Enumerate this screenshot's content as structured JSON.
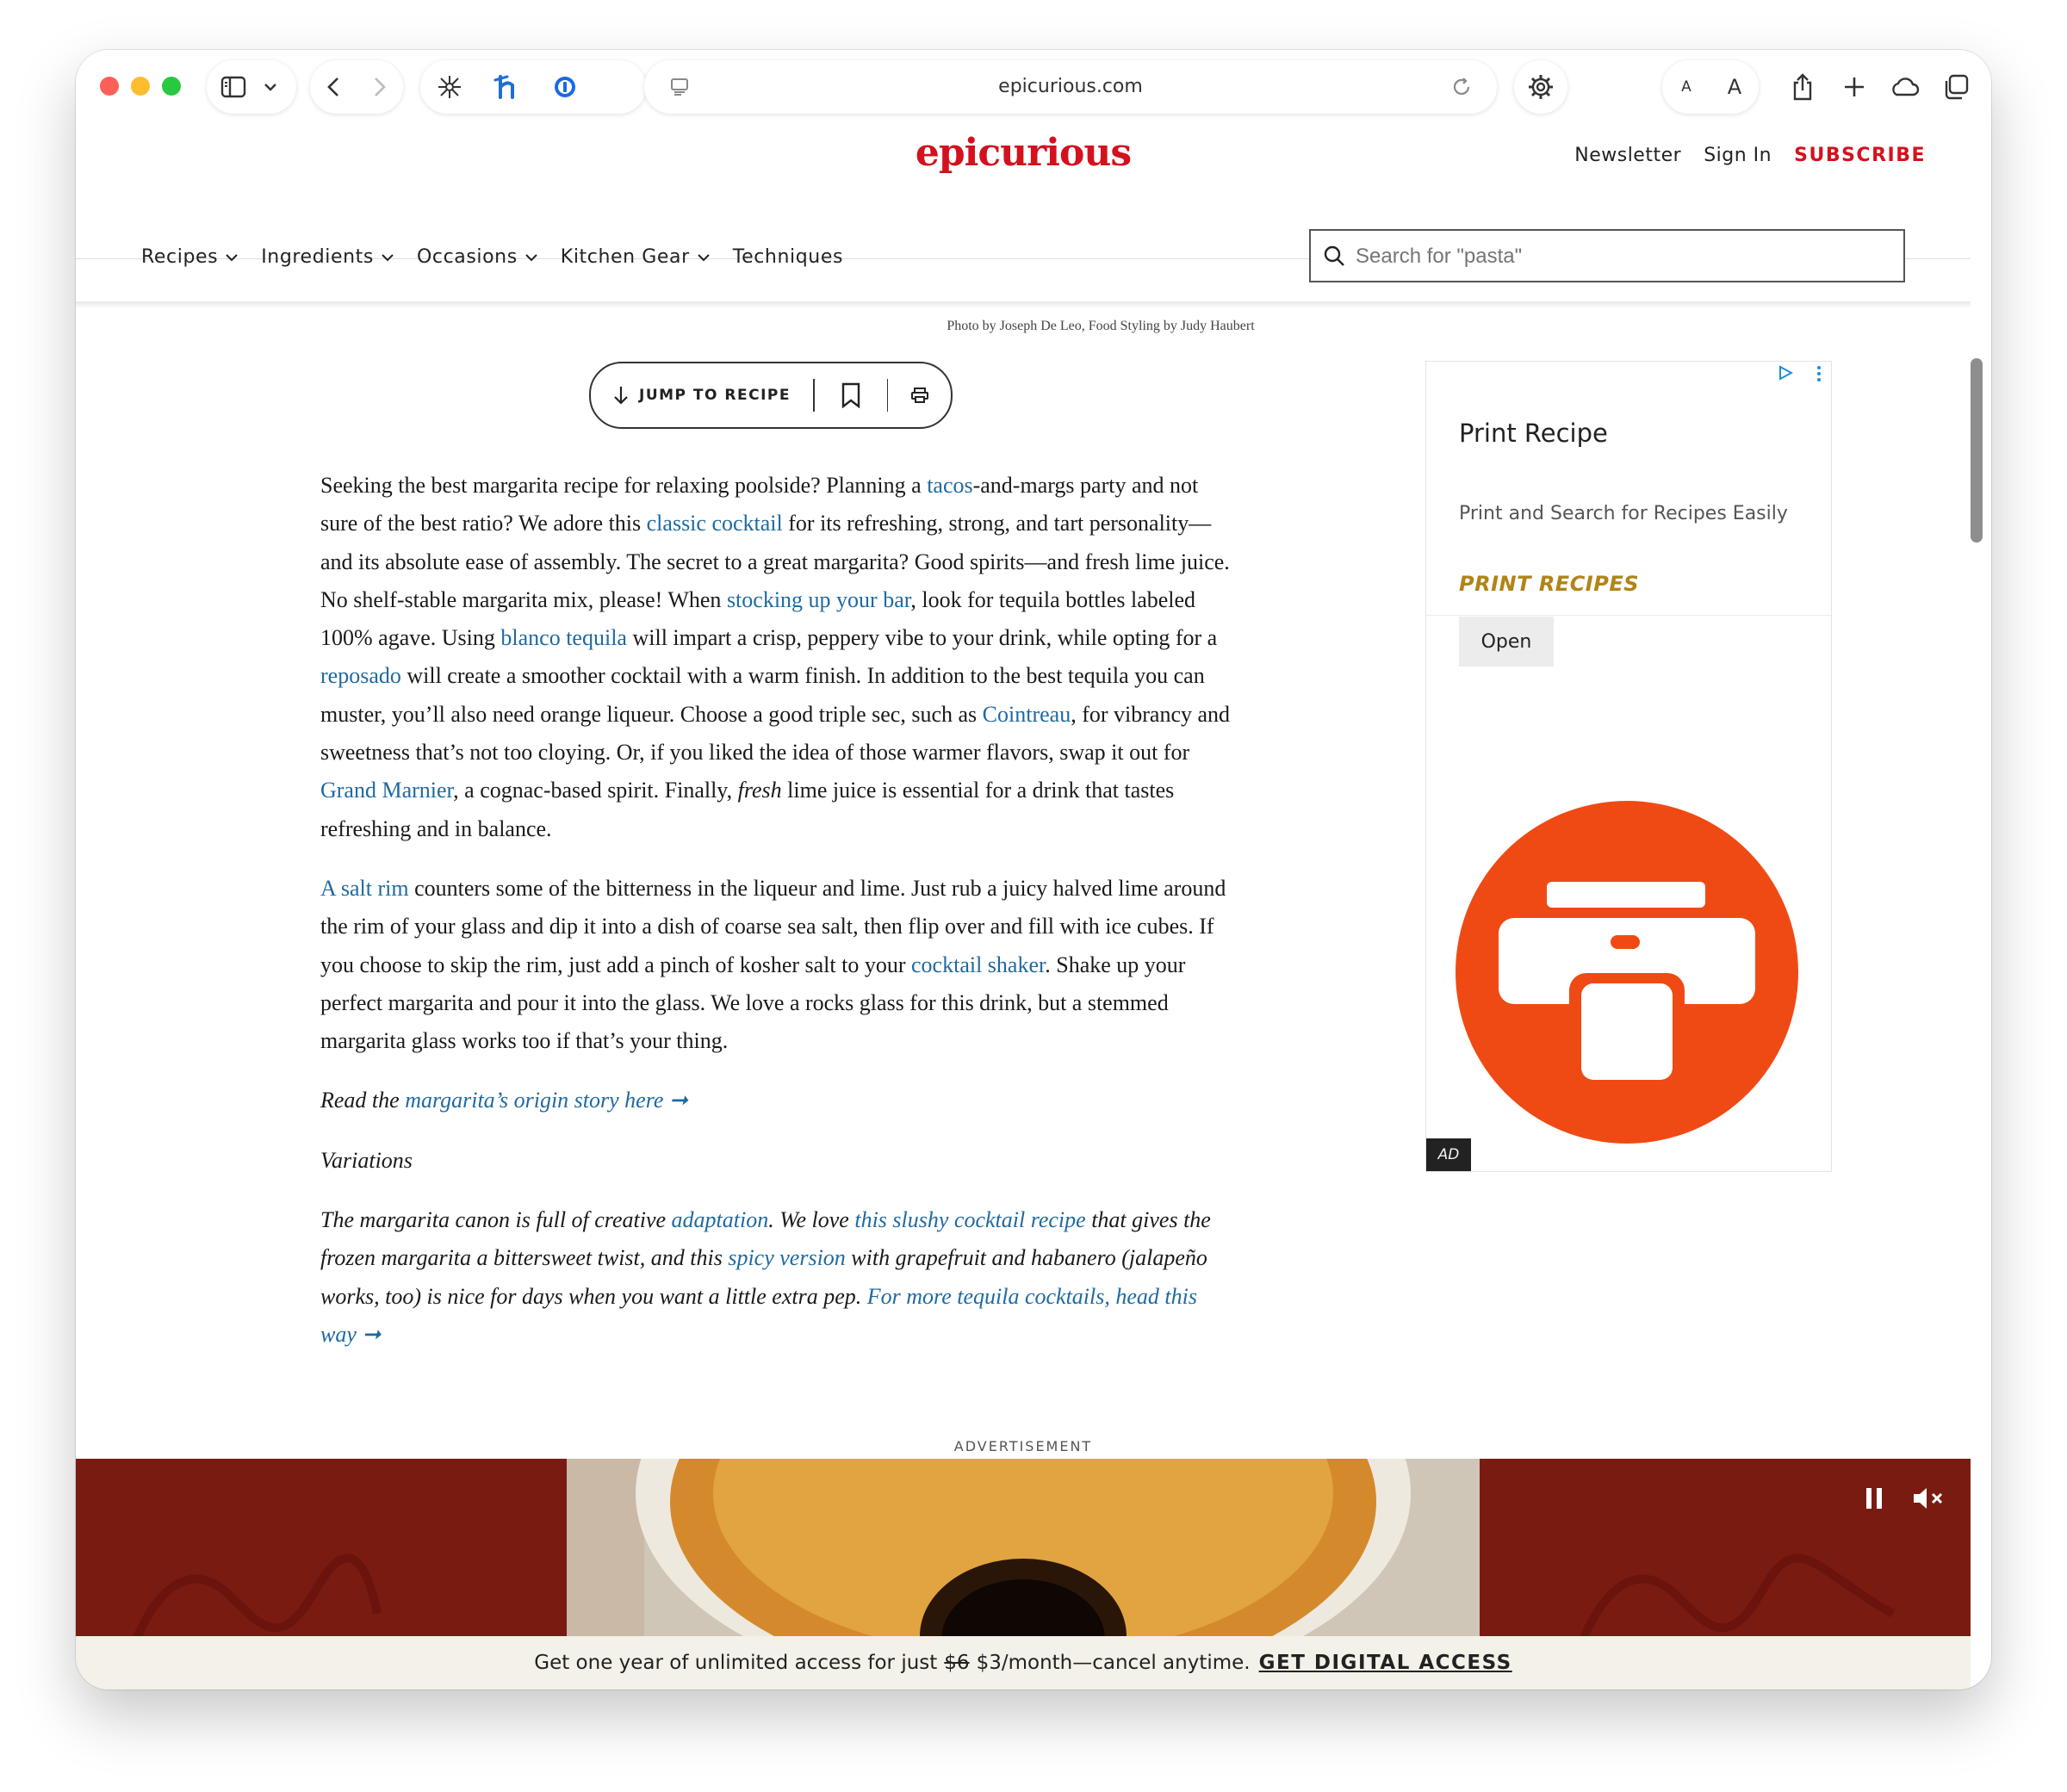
{
  "browser": {
    "url": "epicurious.com",
    "reader_small_a": "A",
    "reader_large_a": "A"
  },
  "site": {
    "logo": "epicurious",
    "header_links": {
      "newsletter": "Newsletter",
      "sign_in": "Sign In",
      "subscribe": "SUBSCRIBE"
    },
    "nav": [
      {
        "label": "Recipes",
        "has_dropdown": true
      },
      {
        "label": "Ingredients",
        "has_dropdown": true
      },
      {
        "label": "Occasions",
        "has_dropdown": true
      },
      {
        "label": "Kitchen Gear",
        "has_dropdown": true
      },
      {
        "label": "Techniques",
        "has_dropdown": false
      }
    ],
    "search_placeholder": "Search for \"pasta\""
  },
  "article": {
    "photo_credit": "Photo by Joseph De Leo, Food Styling by Judy Haubert",
    "jump_to_recipe": "JUMP TO RECIPE",
    "p1": {
      "t1": "Seeking the best margarita recipe for relaxing poolside? Planning a ",
      "l1": "tacos",
      "t2": "-and-margs party and not sure of the best ratio? We adore this ",
      "l2": "classic cocktail",
      "t3": " for its refreshing, strong, and tart personality—and its absolute ease of assembly. The secret to a great margarita? Good spirits—and fresh lime juice. No shelf-stable margarita mix, please! When ",
      "l3": "stocking up your bar",
      "t4": ", look for tequila bottles labeled 100% agave. Using ",
      "l4": "blanco tequila",
      "t5": " will impart a crisp, peppery vibe to your drink, while opting for a ",
      "l5": "reposado",
      "t6": " will create a smoother cocktail with a warm finish. In addition to the best tequila you can muster, you’ll also need orange liqueur. Choose a good triple sec, such as ",
      "l6": "Cointreau",
      "t7": ", for vibrancy and sweetness that’s not too cloying. Or, if you liked the idea of those warmer flavors, swap it out for ",
      "l7": "Grand Marnier",
      "t8": ", a cognac-based spirit. Finally, ",
      "e1": "fresh",
      "t9": " lime juice is essential for a drink that tastes refreshing and in balance."
    },
    "p2": {
      "l1": "A salt rim",
      "t1": " counters some of the bitterness in the liqueur and lime. Just rub a juicy halved lime around the rim of your glass and dip it into a dish of coarse sea salt, then flip over and fill with ice cubes. If you choose to skip the rim, just add a pinch of kosher salt to your ",
      "l2": "cocktail shaker",
      "t2": ". Shake up your perfect margarita and pour it into the glass. We love a rocks glass for this drink, but a stemmed margarita glass works too if that’s your thing."
    },
    "p3": {
      "t1": "Read the ",
      "l1": "margarita’s origin story here ➞"
    },
    "p4": "Variations",
    "p5": {
      "t1": "The margarita canon is full of creative ",
      "l1": "adaptation",
      "t2": ". We love ",
      "l2": "this slushy cocktail recipe",
      "t3": " that gives the frozen margarita a bittersweet twist, and this ",
      "l3": "spicy version",
      "t4": " with grapefruit and habanero (jalapeño works, too) is nice for days when you want a little extra pep. ",
      "l4": "For more tequila cocktails, head this way ➞"
    }
  },
  "side_ad": {
    "title": "Print Recipe",
    "description": "Print and Search for Recipes Easily",
    "cta": "PRINT RECIPES",
    "open_button": "Open",
    "label": "AD",
    "brand_color": "#f04a14"
  },
  "bottom_ad": {
    "label": "ADVERTISEMENT"
  },
  "paywall": {
    "t1": "Get one year of unlimited access for just",
    "old_price": "$6",
    "t2": "$3/month—cancel anytime.",
    "cta": "GET DIGITAL ACCESS"
  },
  "colors": {
    "brand_red": "#d4111e",
    "link_blue": "#1e6aa1",
    "ad_gold": "#b08418"
  }
}
